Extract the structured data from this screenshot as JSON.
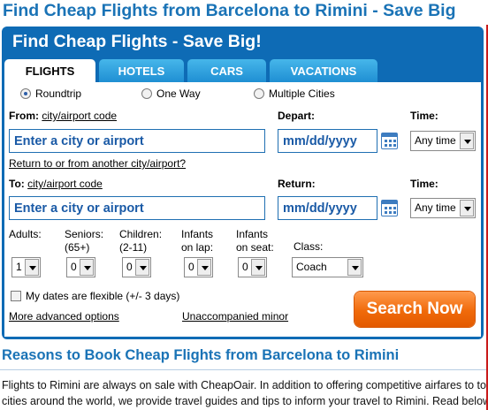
{
  "page_title": "Find Cheap Flights from Barcelona to Rimini - Save Big",
  "widget": {
    "title": "Find Cheap Flights - Save Big!",
    "tabs": [
      {
        "label": "FLIGHTS",
        "active": true
      },
      {
        "label": "HOTELS",
        "active": false
      },
      {
        "label": "CARS",
        "active": false
      },
      {
        "label": "VACATIONS",
        "active": false
      }
    ],
    "trip_types": [
      {
        "label": "Roundtrip",
        "selected": true
      },
      {
        "label": "One Way",
        "selected": false
      },
      {
        "label": "Multiple Cities",
        "selected": false
      }
    ],
    "from": {
      "label": "From:",
      "hint": "city/airport code",
      "placeholder": "Enter a city or airport"
    },
    "return_other_link": "Return to or from another city/airport?",
    "to": {
      "label": "To:",
      "hint": "city/airport code",
      "placeholder": "Enter a city or airport"
    },
    "depart": {
      "label": "Depart:",
      "placeholder": "mm/dd/yyyy"
    },
    "return": {
      "label": "Return:",
      "placeholder": "mm/dd/yyyy"
    },
    "time_label": "Time:",
    "depart_time": "Any time",
    "return_time": "Any time",
    "travelers": {
      "adults": {
        "label_1": "Adults:",
        "label_2": "",
        "value": "1"
      },
      "seniors": {
        "label_1": "Seniors:",
        "label_2": "(65+)",
        "value": "0"
      },
      "children": {
        "label_1": "Children:",
        "label_2": "(2-11)",
        "value": "0"
      },
      "infants_lap": {
        "label_1": "Infants",
        "label_2": "on lap:",
        "value": "0"
      },
      "infants_seat": {
        "label_1": "Infants",
        "label_2": "on seat:",
        "value": "0"
      },
      "class": {
        "label": "Class:",
        "value": "Coach"
      }
    },
    "flexible_dates": "My dates are flexible (+/- 3 days)",
    "advanced_options_link": "More advanced options",
    "unaccompanied_minor_link": "Unaccompanied minor",
    "search_button": "Search Now"
  },
  "reasons_heading": "Reasons to Book Cheap Flights from Barcelona to Rimini",
  "body_lines": [
    "Flights to Rimini are always on sale with CheapOair. In addition to offering competitive airfares to top",
    "cities around the world, we provide travel guides and tips to inform your travel to Rimini. Read below"
  ],
  "colors": {
    "brand_blue": "#0e6bb5",
    "search_orange": "#f06a0a",
    "heading_blue": "#1a73b6"
  }
}
